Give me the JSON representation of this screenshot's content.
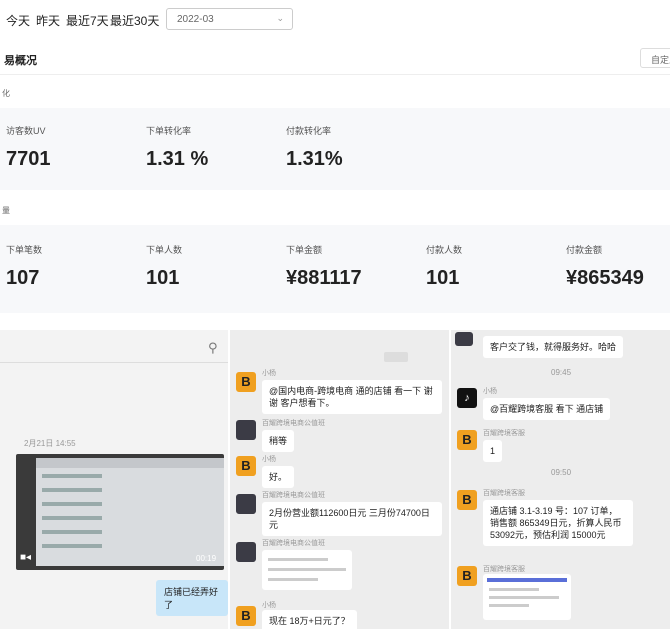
{
  "filters": {
    "tabs": [
      "今天",
      "昨天",
      "最近7天",
      "最近30天"
    ],
    "date_value": "2022-03"
  },
  "overview": {
    "title": "易概况",
    "button_label": "自定义",
    "group1_label": "化",
    "group2_label": "量",
    "row1": [
      {
        "label": "访客数UV",
        "value": "7701"
      },
      {
        "label": "下单转化率",
        "value": "1.31 %"
      },
      {
        "label": "付款转化率",
        "value": "1.31%"
      }
    ],
    "row2": [
      {
        "label": "下单笔数",
        "value": "107"
      },
      {
        "label": "下单人数",
        "value": "101"
      },
      {
        "label": "下单金额",
        "value": "¥881117"
      },
      {
        "label": "付款人数",
        "value": "101"
      },
      {
        "label": "付款金额",
        "value": "¥865349"
      }
    ]
  },
  "chat_left": {
    "date": "2月21日 14:55",
    "video_duration": "00:19",
    "bubble": "店铺已经弄好了"
  },
  "chat_mid": {
    "m1_name": "小杨",
    "m1_text": "@国内电商-跨境电商   通的店铺 看一下 谢谢 客户想看下。",
    "m2_name": "百耀跨境电商公值班",
    "m2_text": "稍等",
    "m3_name": "小杨",
    "m3_text": "好。",
    "m4_name": "百耀跨境电商公值班",
    "m4_text": "2月份营业额112600日元 三月份74700日元",
    "m5_name": "百耀跨境电商公值班",
    "m6_name": "小杨",
    "m6_text": "现在 18万+日元了？"
  },
  "chat_right": {
    "r0_text": "客户交了钱，就得服务好。哈哈",
    "time1": "09:45",
    "r1_name": "小杨",
    "r1_text": "@百耀跨境客服  看下     通店铺",
    "r2_name": "百耀跨境客服",
    "r2_text": "1",
    "time2": "09:50",
    "r3_name": "百耀跨境客服",
    "r3_text": "   通店铺 3.1-3.19 号：107 订单，销售额 865349日元，折算人民币 53092元，预估利润 15000元",
    "r4_name": "百耀跨境客服"
  }
}
